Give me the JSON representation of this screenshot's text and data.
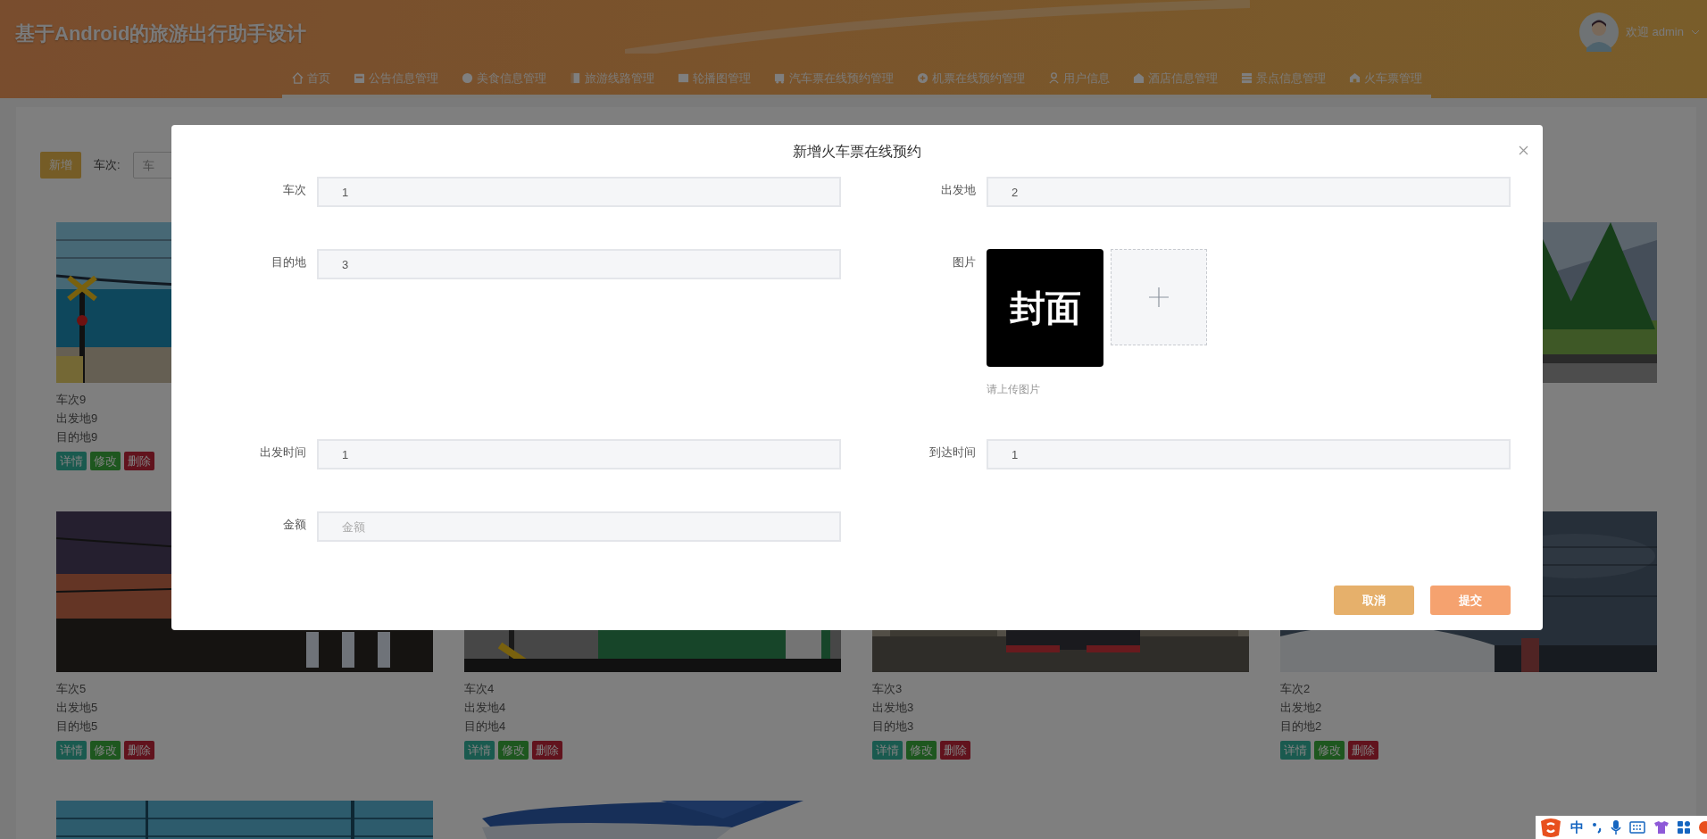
{
  "header": {
    "title": "基于Android的旅游出行助手设计",
    "user": {
      "greeting": "欢迎 admin"
    },
    "nav": [
      {
        "label": "首页"
      },
      {
        "label": "公告信息管理"
      },
      {
        "label": "美食信息管理"
      },
      {
        "label": "旅游线路管理"
      },
      {
        "label": "轮播图管理"
      },
      {
        "label": "汽车票在线预约管理"
      },
      {
        "label": "机票在线预约管理"
      },
      {
        "label": "用户信息"
      },
      {
        "label": "酒店信息管理"
      },
      {
        "label": "景点信息管理"
      },
      {
        "label": "火车票管理"
      }
    ]
  },
  "toolbar": {
    "add_button": "新增",
    "search_label": "车次:",
    "search_placeholder": "车"
  },
  "card_rows": [
    [
      {
        "image": {
          "kind": "picture"
        },
        "title": "车次9",
        "origin": "出发地9",
        "destination": "目的地9",
        "actions": [
          {
            "kind": "detail",
            "label": "详情"
          },
          {
            "kind": "edit",
            "label": "修改"
          },
          {
            "kind": "delete",
            "label": "删除"
          }
        ]
      },
      null,
      null,
      {
        "image": {
          "kind": "picture"
        }
      }
    ],
    [
      {
        "image": {
          "kind": "picture"
        },
        "title": "车次5",
        "origin": "出发地5",
        "destination": "目的地5",
        "actions": [
          {
            "kind": "detail",
            "label": "详情"
          },
          {
            "kind": "edit",
            "label": "修改"
          },
          {
            "kind": "delete",
            "label": "删除"
          }
        ]
      },
      {
        "image": {
          "kind": "picture"
        },
        "title": "车次4",
        "origin": "出发地4",
        "destination": "目的地4",
        "actions": [
          {
            "kind": "detail",
            "label": "详情"
          },
          {
            "kind": "edit",
            "label": "修改"
          },
          {
            "kind": "delete",
            "label": "删除"
          }
        ]
      },
      {
        "image": {
          "kind": "picture"
        },
        "title": "车次3",
        "origin": "出发地3",
        "destination": "目的地3",
        "actions": [
          {
            "kind": "detail",
            "label": "详情"
          },
          {
            "kind": "edit",
            "label": "修改"
          },
          {
            "kind": "delete",
            "label": "删除"
          }
        ]
      },
      {
        "image": {
          "kind": "picture"
        },
        "title": "车次2",
        "origin": "出发地2",
        "destination": "目的地2",
        "actions": [
          {
            "kind": "detail",
            "label": "详情"
          },
          {
            "kind": "edit",
            "label": "修改"
          },
          {
            "kind": "delete",
            "label": "删除"
          }
        ]
      }
    ],
    [
      {
        "image": {
          "kind": "picture"
        }
      },
      {
        "image": {
          "kind": "picture"
        }
      }
    ]
  ],
  "dialog": {
    "title": "新增火车票在线预约",
    "fields": [
      {
        "kind": "text",
        "label": "车次",
        "value": "1"
      },
      {
        "kind": "text",
        "label": "出发地",
        "value": "2"
      },
      {
        "kind": "text",
        "label": "目的地",
        "value": "3"
      },
      {
        "kind": "upload",
        "label": "图片",
        "cover_text": "封面",
        "hint": "请上传图片"
      },
      {
        "kind": "text",
        "label": "出发时间",
        "value": "1"
      },
      {
        "kind": "text",
        "label": "到达时间",
        "value": "1"
      },
      {
        "kind": "text",
        "label": "金额",
        "placeholder": "金额"
      }
    ],
    "buttons": [
      {
        "kind": "cancel",
        "label": "取消"
      },
      {
        "kind": "submit",
        "label": "提交"
      }
    ]
  },
  "ime_bar": {
    "mode": "中"
  }
}
